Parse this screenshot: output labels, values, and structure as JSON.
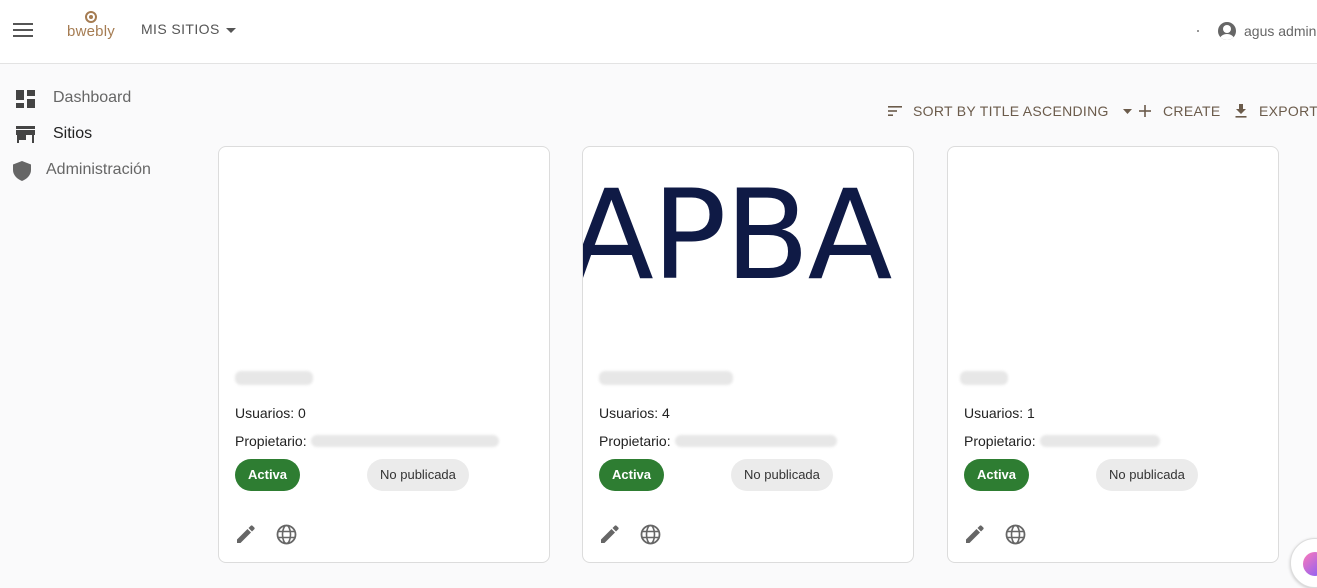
{
  "header": {
    "logo_text": "bwebly",
    "sites_menu_label": "MIS SITIOS",
    "user_name": "agus admin"
  },
  "sidebar": {
    "items": [
      {
        "label": "Dashboard",
        "icon": "dashboard-icon"
      },
      {
        "label": "Sitios",
        "icon": "store-icon"
      },
      {
        "label": "Administración",
        "icon": "shield-icon"
      }
    ]
  },
  "toolbar": {
    "sort_label": "SORT BY TITLE ASCENDING",
    "create_label": "CREATE",
    "export_label": "EXPORT"
  },
  "cards": [
    {
      "users_label": "Usuarios: 0",
      "owner_label": "Propietario:",
      "status_label": "Activa",
      "publish_label": "No publicada",
      "logo_text": ""
    },
    {
      "users_label": "Usuarios: 4",
      "owner_label": "Propietario:",
      "status_label": "Activa",
      "publish_label": "No publicada",
      "logo_text": "APBA"
    },
    {
      "users_label": "Usuarios: 1",
      "owner_label": "Propietario:",
      "status_label": "Activa",
      "publish_label": "No publicada",
      "logo_text": ""
    }
  ],
  "colors": {
    "brand": "#a57c52",
    "active_chip": "#2e7d32",
    "logo_navy": "#0f1a45"
  }
}
